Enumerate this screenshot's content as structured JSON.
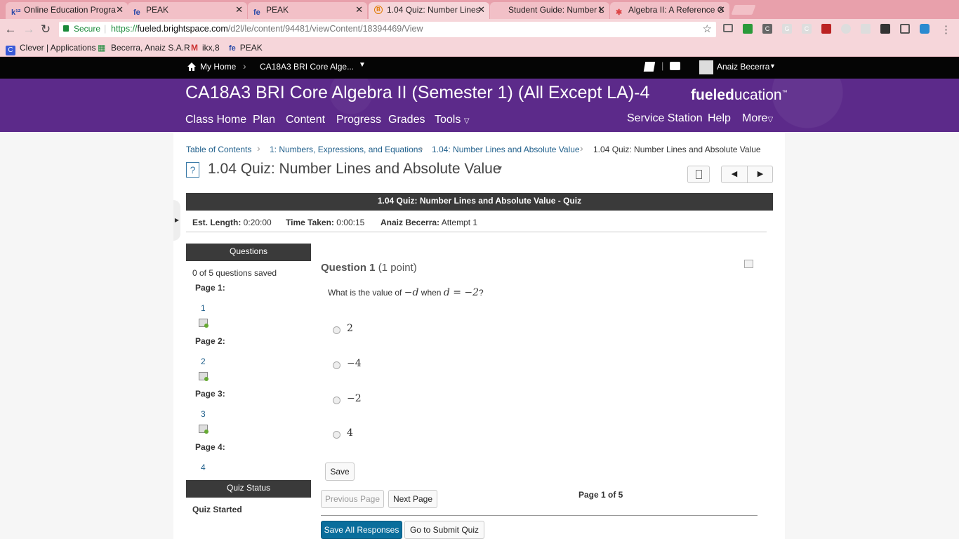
{
  "browser": {
    "tabs": [
      {
        "icon": "k¹²",
        "label": "Online Education Progra"
      },
      {
        "icon": "fe",
        "label": "PEAK"
      },
      {
        "icon": "fe",
        "label": "PEAK"
      },
      {
        "icon": "B",
        "label": "1.04 Quiz: Number Lines"
      },
      {
        "icon": "",
        "label": "Student Guide: Number L"
      },
      {
        "icon": "",
        "label": "Algebra II: A Reference G"
      }
    ],
    "secure_label": "Secure",
    "url_scheme": "https://",
    "url_host": "fueled.brightspace.com",
    "url_path": "/d2l/le/content/94481/viewContent/18394469/View",
    "bookmarks": [
      {
        "icon": "C",
        "label": "Clever | Applications"
      },
      {
        "icon": "▦",
        "label": "Becerra, Anaiz S.A.R"
      },
      {
        "icon": "M",
        "label": "ikx,8"
      },
      {
        "icon": "fe",
        "label": "PEAK"
      }
    ]
  },
  "minibar": {
    "home_label": "My Home",
    "course_label": "CA18A3 BRI Core Alge...",
    "user_name": "Anaiz Becerra"
  },
  "header": {
    "course_title": "CA18A3 BRI Core Algebra II (Semester 1) (All Except LA)-4",
    "logo_bold": "fueled",
    "logo_regular": "ucation",
    "logo_tm": "™",
    "nav": [
      "Class Home",
      "Plan",
      "Content",
      "Progress",
      "Grades",
      "Tools"
    ],
    "nav_right": [
      "Service Station",
      "Help",
      "More"
    ]
  },
  "breadcrumbs": [
    "Table of Contents",
    "1: Numbers, Expressions, and Equations",
    "1.04: Number Lines and Absolute Value",
    "1.04 Quiz: Number Lines and Absolute Value"
  ],
  "page": {
    "title": "1.04 Quiz: Number Lines and Absolute Value",
    "banner": "1.04 Quiz: Number Lines and Absolute Value - Quiz",
    "est_length_label": "Est. Length:",
    "est_length_value": "0:20:00",
    "time_taken_label": "Time Taken:",
    "time_taken_value": "0:00:15",
    "attempt_user": "Anaiz Becerra:",
    "attempt_value": "Attempt 1"
  },
  "sidebar": {
    "questions_header": "Questions",
    "saved_status": "0 of 5 questions saved",
    "pages": [
      {
        "label": "Page 1:",
        "question": "1"
      },
      {
        "label": "Page 2:",
        "question": "2"
      },
      {
        "label": "Page 3:",
        "question": "3"
      },
      {
        "label": "Page 4:",
        "question": "4"
      }
    ],
    "status_header": "Quiz Status",
    "status_value": "Quiz Started"
  },
  "question": {
    "title": "Question 1",
    "points": "(1 point)",
    "prompt_pre": "What is the value of",
    "prompt_expr1": "−d",
    "prompt_mid": "when",
    "prompt_expr2": "d = −2",
    "prompt_post": "?",
    "options": [
      "2",
      "−4",
      "−2",
      "4"
    ]
  },
  "actions": {
    "save": "Save",
    "previous_page": "Previous Page",
    "next_page": "Next Page",
    "page_indicator": "Page 1 of 5",
    "save_all": "Save All Responses",
    "submit": "Go to Submit Quiz"
  }
}
